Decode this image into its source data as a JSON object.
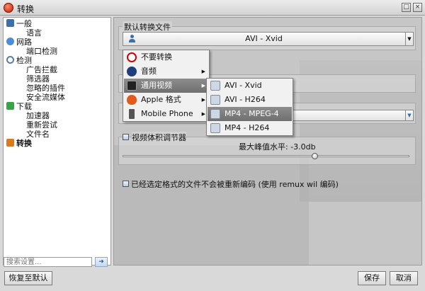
{
  "window": {
    "title": "转换",
    "controls": [
      "□",
      "×"
    ]
  },
  "sidebar": {
    "items": [
      {
        "label": "一般",
        "color": "#3a6fb0",
        "children": [
          "语言"
        ]
      },
      {
        "label": "网路",
        "color": "#4b8fd6",
        "children": [
          "端口检测"
        ]
      },
      {
        "label": "检测",
        "color": "#5c7da8",
        "children": [
          "广告拦截",
          "筛选器",
          "忽略的插件",
          "安全流媒体"
        ]
      },
      {
        "label": "下载",
        "color": "#3aa34a",
        "children": [
          "加速器",
          "重新尝试",
          "文件名"
        ]
      },
      {
        "label": "转换",
        "color": "#d97a1c",
        "children": []
      }
    ],
    "search_placeholder": "搜索设置..."
  },
  "main": {
    "default_group_title": "默认转换文件",
    "default_combo_value": "AVI - Xvid",
    "volume_group_title": "视频体积调节器",
    "volume_label": "最大峰值水平: -3.0db",
    "volume_level_fraction": 0.67,
    "no_reencode_label": "已经选定格式的文件不会被重新编码 (使用 remux wil 编码)"
  },
  "menu": {
    "items": [
      "不要转换",
      "音频",
      "通用视频",
      "Apple 格式",
      "Mobile Phone"
    ],
    "selected": "通用视频",
    "submenu": [
      "AVI - Xvid",
      "AVI - H264",
      "MP4 - MPEG-4",
      "MP4 - H264"
    ],
    "submenu_selected": "MP4 - MPEG-4"
  },
  "footer": {
    "reset_label": "恢复至默认",
    "save_label": "保存",
    "cancel_label": "取消"
  },
  "colors": {
    "accent": "#3a6fb0",
    "selection": "#7a7a7a"
  }
}
